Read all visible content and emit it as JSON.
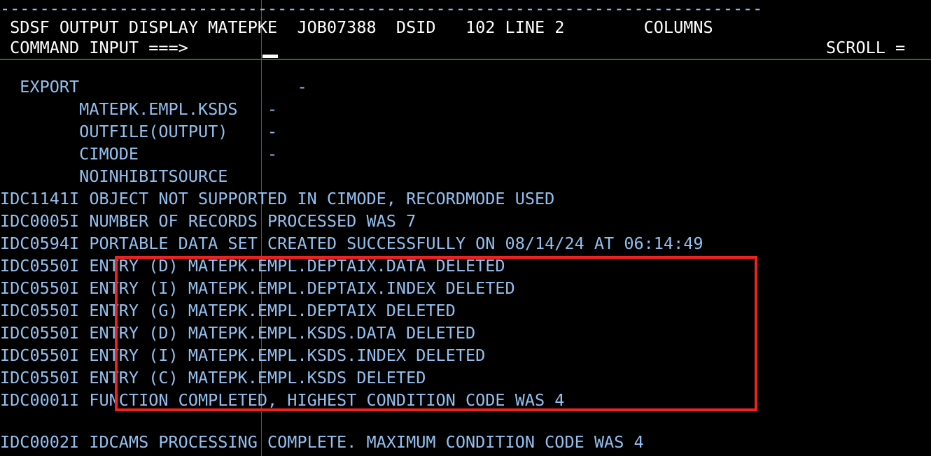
{
  "terminal": {
    "app": "SDSF OUTPUT DISPLAY",
    "background_color": "#000000",
    "text_color": "#93c0ef",
    "header_text_color": "#ffffff",
    "rule_color": "#1f7a1f",
    "annotation_color": "#ef2222"
  },
  "top_rule": "-----------------------------------------------------------------------------",
  "header": {
    "title_line": " SDSF OUTPUT DISPLAY MATEPKE  JOB07388  DSID   102 LINE 2        COLUMNS",
    "panel": "SDSF OUTPUT DISPLAY",
    "user": "MATEPKE",
    "jobid": "JOB07388",
    "dsid_label": "DSID",
    "dsid_value": "102",
    "line_label": "LINE",
    "line_value": "2",
    "columns_label": "COLUMNS",
    "command_line": " COMMAND INPUT ===>",
    "command_label": "COMMAND INPUT ===>",
    "command_value": "",
    "scroll_label": "SCROLL ="
  },
  "output_lines": [
    {
      "id": "line-blank-1",
      "text": ""
    },
    {
      "id": "line-export",
      "text": "  EXPORT                      -"
    },
    {
      "id": "line-dsname",
      "text": "        MATEPK.EMPL.KSDS   -"
    },
    {
      "id": "line-outfile",
      "text": "        OUTFILE(OUTPUT)    -"
    },
    {
      "id": "line-cimode",
      "text": "        CIMODE             -"
    },
    {
      "id": "line-noinhibit",
      "text": "        NOINHIBITSOURCE"
    },
    {
      "id": "line-idc1141i",
      "text": "IDC1141I OBJECT NOT SUPPORTED IN CIMODE, RECORDMODE USED"
    },
    {
      "id": "line-idc0005i",
      "text": "IDC0005I NUMBER OF RECORDS PROCESSED WAS 7"
    },
    {
      "id": "line-idc0594i",
      "text": "IDC0594I PORTABLE DATA SET CREATED SUCCESSFULLY ON 08/14/24 AT 06:14:49"
    },
    {
      "id": "line-del-deptaix-data",
      "text": "IDC0550I ENTRY (D) MATEPK.EMPL.DEPTAIX.DATA DELETED"
    },
    {
      "id": "line-del-deptaix-index",
      "text": "IDC0550I ENTRY (I) MATEPK.EMPL.DEPTAIX.INDEX DELETED"
    },
    {
      "id": "line-del-deptaix",
      "text": "IDC0550I ENTRY (G) MATEPK.EMPL.DEPTAIX DELETED"
    },
    {
      "id": "line-del-ksds-data",
      "text": "IDC0550I ENTRY (D) MATEPK.EMPL.KSDS.DATA DELETED"
    },
    {
      "id": "line-del-ksds-index",
      "text": "IDC0550I ENTRY (I) MATEPK.EMPL.KSDS.INDEX DELETED"
    },
    {
      "id": "line-del-ksds",
      "text": "IDC0550I ENTRY (C) MATEPK.EMPL.KSDS DELETED"
    },
    {
      "id": "line-idc0001i",
      "text": "IDC0001I FUNCTION COMPLETED, HIGHEST CONDITION CODE WAS 4"
    },
    {
      "id": "line-blank-2",
      "text": ""
    },
    {
      "id": "line-idc0002i",
      "text": "IDC0002I IDCAMS PROCESSING COMPLETE. MAXIMUM CONDITION CODE WAS 4"
    }
  ],
  "messages": {
    "idc1141i": {
      "code": "IDC1141I",
      "text": "OBJECT NOT SUPPORTED IN CIMODE, RECORDMODE USED"
    },
    "idc0005i": {
      "code": "IDC0005I",
      "text": "NUMBER OF RECORDS PROCESSED WAS 7",
      "records": "7"
    },
    "idc0594i": {
      "code": "IDC0594I",
      "text": "PORTABLE DATA SET CREATED SUCCESSFULLY ON 08/14/24 AT 06:14:49",
      "date": "08/14/24",
      "time": "06:14:49"
    },
    "idc0001i": {
      "code": "IDC0001I",
      "text": "FUNCTION COMPLETED, HIGHEST CONDITION CODE WAS 4",
      "condition_code": "4"
    },
    "idc0002i": {
      "code": "IDC0002I",
      "text": "IDCAMS PROCESSING COMPLETE. MAXIMUM CONDITION CODE WAS 4",
      "condition_code": "4"
    }
  },
  "deleted_entries": [
    {
      "code": "IDC0550I",
      "type": "D",
      "dsname": "MATEPK.EMPL.DEPTAIX.DATA",
      "status": "DELETED"
    },
    {
      "code": "IDC0550I",
      "type": "I",
      "dsname": "MATEPK.EMPL.DEPTAIX.INDEX",
      "status": "DELETED"
    },
    {
      "code": "IDC0550I",
      "type": "G",
      "dsname": "MATEPK.EMPL.DEPTAIX",
      "status": "DELETED"
    },
    {
      "code": "IDC0550I",
      "type": "D",
      "dsname": "MATEPK.EMPL.KSDS.DATA",
      "status": "DELETED"
    },
    {
      "code": "IDC0550I",
      "type": "I",
      "dsname": "MATEPK.EMPL.KSDS.INDEX",
      "status": "DELETED"
    },
    {
      "code": "IDC0550I",
      "type": "C",
      "dsname": "MATEPK.EMPL.KSDS",
      "status": "DELETED"
    }
  ],
  "export_command": {
    "verb": "EXPORT",
    "dsname": "MATEPK.EMPL.KSDS",
    "outfile": "OUTFILE(OUTPUT)",
    "cimode": "CIMODE",
    "noinhibitsource": "NOINHIBITSOURCE",
    "continuation": "-"
  }
}
